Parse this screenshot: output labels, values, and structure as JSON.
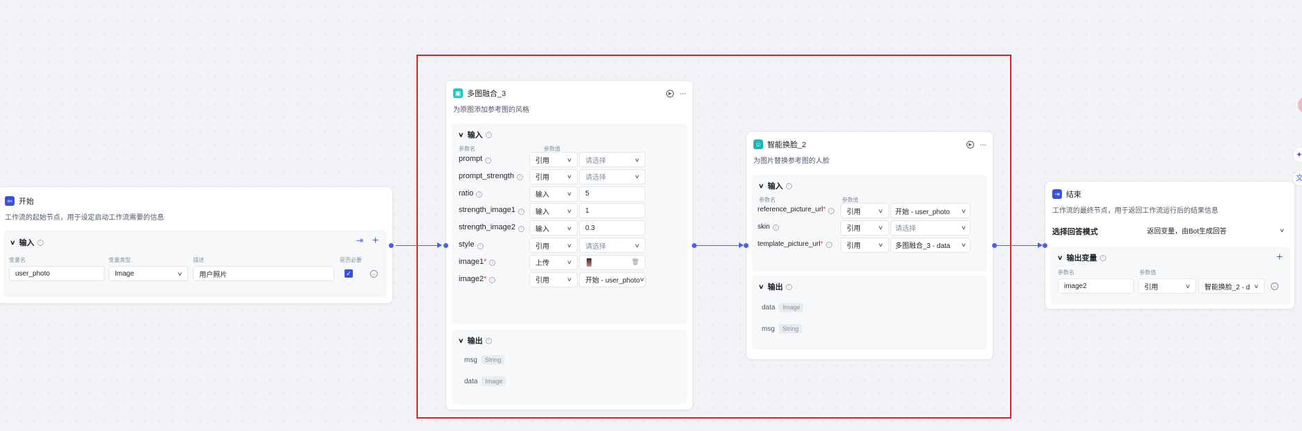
{
  "start_node": {
    "title": "开始",
    "desc": "工作流的起始节点，用于设定启动工作流需要的信息",
    "input_label": "输入",
    "col_headers": [
      "变量名",
      "变量类型",
      "描述",
      "是否必要"
    ],
    "var_name": "user_photo",
    "var_type": "Image",
    "var_desc": "用户照片"
  },
  "blend_node": {
    "title": "多图融合_3",
    "desc": "为原图添加参考图的风格",
    "input_label": "输入",
    "col_param": "参数名",
    "col_value": "参数值",
    "params": [
      {
        "name": "prompt",
        "required": "",
        "mode": "引用",
        "value": "请选择",
        "placeholder": true,
        "has_dropdown": true
      },
      {
        "name": "prompt_strength",
        "required": "",
        "mode": "引用",
        "value": "请选择",
        "placeholder": true,
        "has_dropdown": true
      },
      {
        "name": "ratio",
        "required": "",
        "mode": "输入",
        "value": "5",
        "placeholder": false,
        "has_dropdown": false
      },
      {
        "name": "strength_image1",
        "required": "",
        "mode": "输入",
        "value": "1",
        "placeholder": false,
        "has_dropdown": false
      },
      {
        "name": "strength_image2",
        "required": "",
        "mode": "输入",
        "value": "0.3",
        "placeholder": false,
        "has_dropdown": false
      },
      {
        "name": "style",
        "required": "",
        "mode": "引用",
        "value": "请选择",
        "placeholder": true,
        "has_dropdown": true
      },
      {
        "name": "image1",
        "required": "*",
        "mode": "上传",
        "value": "",
        "placeholder": false,
        "has_dropdown": false
      },
      {
        "name": "image2",
        "required": "*",
        "mode": "引用",
        "value": "开始 - user_photo",
        "placeholder": false,
        "has_dropdown": true
      }
    ],
    "output_label": "输出",
    "outputs": [
      {
        "name": "msg",
        "type": "String"
      },
      {
        "name": "data",
        "type": "Image"
      }
    ]
  },
  "faceswap_node": {
    "title": "智能换脸_2",
    "desc": "为图片替换参考图的人脸",
    "input_label": "输入",
    "col_param": "参数名",
    "col_value": "参数值",
    "params": [
      {
        "name": "reference_picture_url",
        "required": "*",
        "mode": "引用",
        "value": "开始 - user_photo",
        "placeholder": false
      },
      {
        "name": "skin",
        "required": "",
        "mode": "引用",
        "value": "请选择",
        "placeholder": true
      },
      {
        "name": "template_picture_url",
        "required": "*",
        "mode": "引用",
        "value": "多图融合_3 - data",
        "placeholder": false
      }
    ],
    "output_label": "输出",
    "outputs": [
      {
        "name": "data",
        "type": "Image"
      },
      {
        "name": "msg",
        "type": "String"
      }
    ]
  },
  "end_node": {
    "title": "结束",
    "desc": "工作流的最终节点，用于返回工作流运行后的结果信息",
    "mode_label": "选择回答模式",
    "mode_value": "返回变量，由Bot生成回答",
    "output_var_label": "输出变量",
    "col_param": "参数名",
    "col_value": "参数值",
    "var_name": "image2",
    "var_mode": "引用",
    "var_value": "智能换脸_2 - d"
  },
  "colors": {
    "accent": "#4e5fea",
    "highlight_border": "#e02020",
    "blend_icon": "#1fc6c6",
    "faceswap_icon": "#1ab8b2",
    "end_icon": "#3d4fe0",
    "start_icon": "#3d4fe0"
  }
}
